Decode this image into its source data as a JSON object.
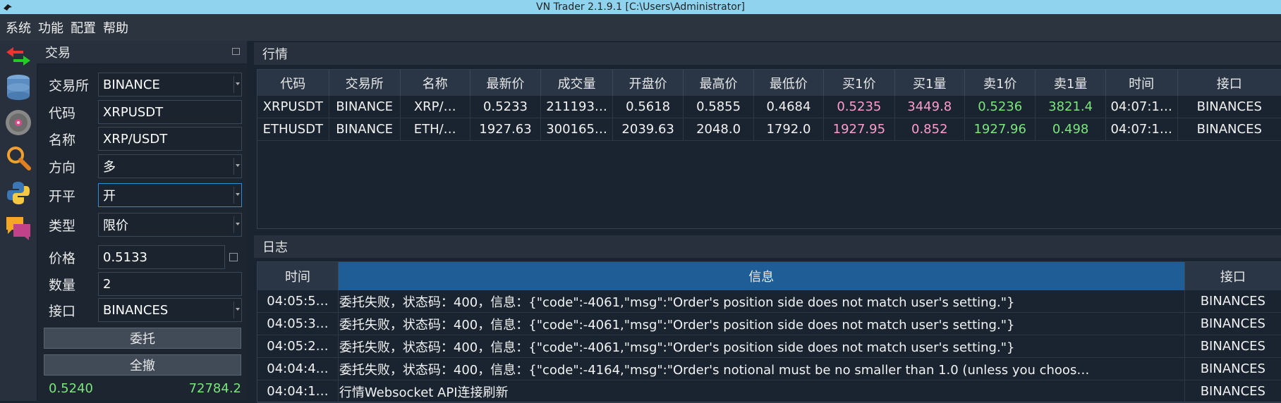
{
  "window": {
    "title": "VN Trader 2.1.9.1 [C:\\Users\\Administrator]"
  },
  "menu": [
    "系统",
    "功能",
    "配置",
    "帮助"
  ],
  "toolbar": {
    "icons": [
      "exchange-arrows-icon",
      "database-icon",
      "disk-icon",
      "magnifier-icon",
      "python-icon",
      "chat-icon"
    ]
  },
  "trade_panel": {
    "title": "交易",
    "fields": {
      "exchange": {
        "label": "交易所",
        "value": "BINANCE"
      },
      "symbol": {
        "label": "代码",
        "value": "XRPUSDT"
      },
      "name": {
        "label": "名称",
        "value": "XRP/USDT"
      },
      "direction": {
        "label": "方向",
        "value": "多"
      },
      "offset": {
        "label": "开平",
        "value": "开"
      },
      "type": {
        "label": "类型",
        "value": "限价"
      },
      "price": {
        "label": "价格",
        "value": "0.5133"
      },
      "volume": {
        "label": "数量",
        "value": "2"
      },
      "gateway": {
        "label": "接口",
        "value": "BINANCES"
      }
    },
    "buttons": {
      "send": "委托",
      "cancel_all": "全撤"
    },
    "footer": {
      "left": "0.5240",
      "right": "72784.2"
    }
  },
  "market": {
    "title": "行情",
    "columns": [
      "代码",
      "交易所",
      "名称",
      "最新价",
      "成交量",
      "开盘价",
      "最高价",
      "最低价",
      "买1价",
      "买1量",
      "卖1价",
      "卖1量",
      "时间",
      "接口"
    ],
    "rows": [
      [
        "XRPUSDT",
        "BINANCE",
        "XRP/…",
        "0.5233",
        "211193…",
        "0.5618",
        "0.5855",
        "0.4684",
        "0.5235",
        "3449.8",
        "0.5236",
        "3821.4",
        "04:07:1…",
        "BINANCES"
      ],
      [
        "ETHUSDT",
        "BINANCE",
        "ETH/…",
        "1927.63",
        "300165…",
        "2039.63",
        "2048.0",
        "1792.0",
        "1927.95",
        "0.852",
        "1927.96",
        "0.498",
        "04:07:1…",
        "BINANCES"
      ]
    ],
    "colors": {
      "bid": "#ff9ccf",
      "ask": "#7ce57c"
    }
  },
  "log": {
    "title": "日志",
    "columns": [
      "时间",
      "信息",
      "接口"
    ],
    "rows": [
      [
        "04:05:5…",
        "委托失败，状态码：400，信息：{\"code\":-4061,\"msg\":\"Order's position side does not match user's setting.\"}",
        "BINANCES"
      ],
      [
        "04:05:3…",
        "委托失败，状态码：400，信息：{\"code\":-4061,\"msg\":\"Order's position side does not match user's setting.\"}",
        "BINANCES"
      ],
      [
        "04:05:2…",
        "委托失败，状态码：400，信息：{\"code\":-4061,\"msg\":\"Order's position side does not match user's setting.\"}",
        "BINANCES"
      ],
      [
        "04:04:4…",
        "委托失败，状态码：400，信息：{\"code\":-4164,\"msg\":\"Order's notional must be no smaller than 1.0 (unless you choos…",
        "BINANCES"
      ],
      [
        "04:04:1…",
        "行情Websocket API连接刷新",
        "BINANCES"
      ]
    ]
  }
}
